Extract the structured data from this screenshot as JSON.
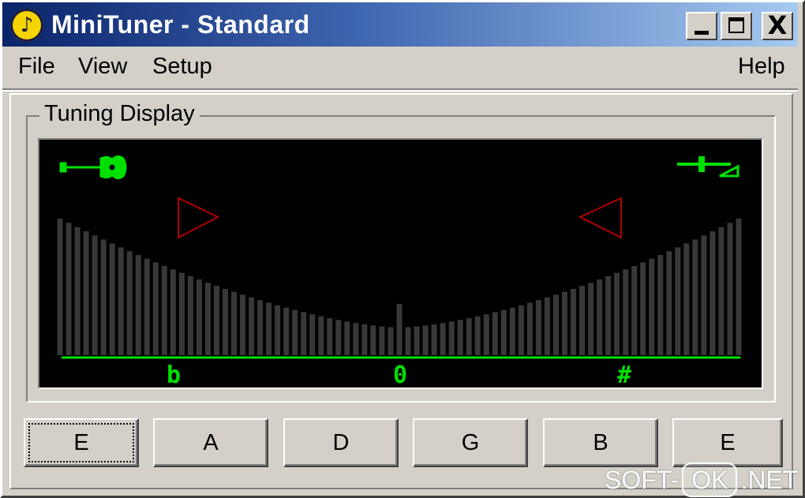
{
  "window": {
    "title": "MiniTuner - Standard",
    "controls": {
      "minimize": "_",
      "maximize": "□",
      "close": "X"
    }
  },
  "menu": [
    {
      "label": "File"
    },
    {
      "label": "View"
    },
    {
      "label": "Setup"
    },
    {
      "label": "Help"
    }
  ],
  "tuning_display": {
    "group_label": "Tuning Display",
    "scale_labels": {
      "flat": "b",
      "center": "0",
      "sharp": "#"
    },
    "colors": {
      "scale": "#00e000",
      "bars": "#383838",
      "arrows": "#b00000",
      "background": "#000000"
    },
    "icons": {
      "left": "guitar-icon",
      "right": "fork-icon"
    },
    "meter": {
      "bar_count": 79,
      "center_bar": true
    }
  },
  "note_buttons": [
    {
      "label": "E",
      "focused": true
    },
    {
      "label": "A",
      "focused": false
    },
    {
      "label": "D",
      "focused": false
    },
    {
      "label": "G",
      "focused": false
    },
    {
      "label": "B",
      "focused": false
    },
    {
      "label": "E",
      "focused": false
    }
  ],
  "watermark": {
    "left": "SOFT-",
    "badge": "OK",
    "right": ".NET"
  }
}
